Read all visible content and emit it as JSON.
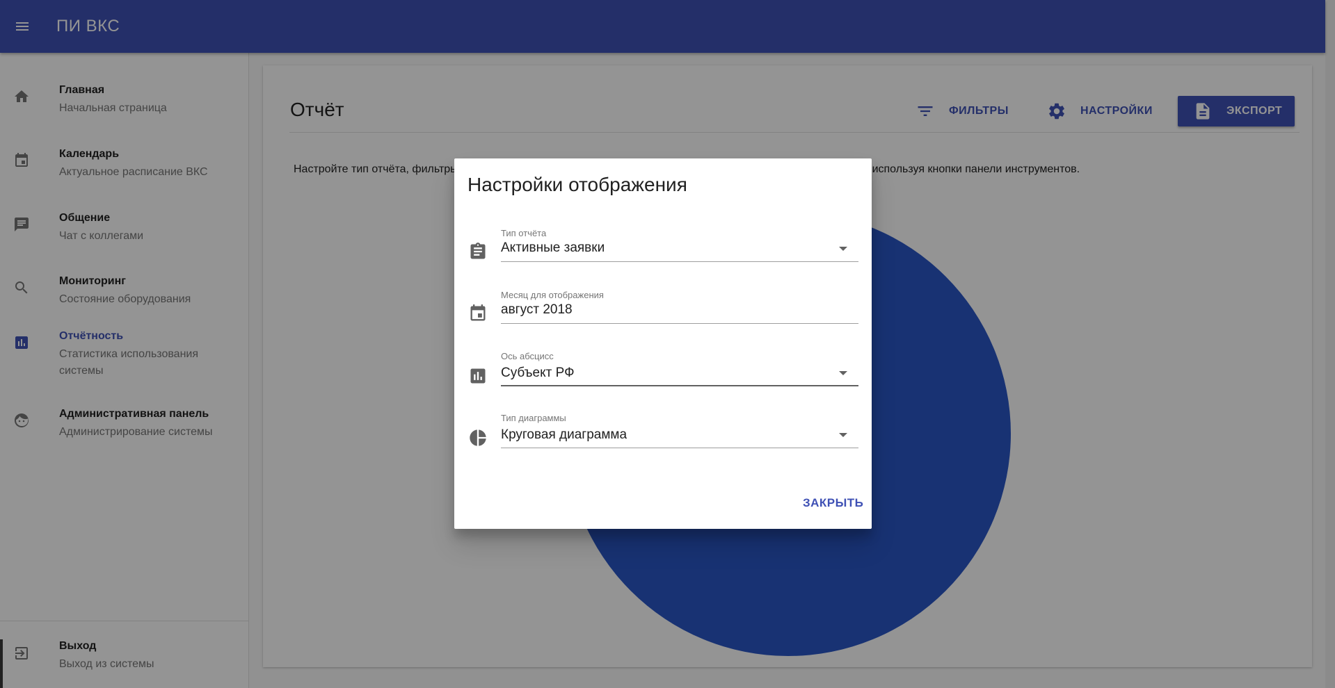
{
  "app": {
    "title": "ПИ ВКС"
  },
  "sidebar": {
    "items": [
      {
        "title": "Главная",
        "subtitle": "Начальная страница",
        "icon": "home-icon"
      },
      {
        "title": "Календарь",
        "subtitle": "Актуальное расписание ВКС",
        "icon": "calendar-icon"
      },
      {
        "title": "Общение",
        "subtitle": "Чат с коллегами",
        "icon": "chat-icon"
      },
      {
        "title": "Мониторинг",
        "subtitle": "Состояние оборудования",
        "icon": "search-icon"
      },
      {
        "title": "Отчётность",
        "subtitle": "Статистика использования системы",
        "icon": "chart-icon",
        "active": true
      },
      {
        "title": "Административная панель",
        "subtitle": "Администрирование системы",
        "icon": "face-icon"
      }
    ],
    "logout": {
      "title": "Выход",
      "subtitle": "Выход из системы",
      "icon": "logout-icon"
    }
  },
  "report": {
    "title": "Отчёт",
    "toolbar": {
      "filters_label": "ФИЛЬТРЫ",
      "settings_label": "НАСТРОЙКИ",
      "export_label": "ЭКСПОРТ"
    },
    "description": "Настройте тип отчёта, фильтры данных и способ отображения, а также экспортируйте полученную диаграмму, используя кнопки панели инструментов."
  },
  "chart_data": {
    "type": "pie",
    "categories": [
      ""
    ],
    "values": [
      100
    ],
    "colors": [
      "#2a56c6"
    ]
  },
  "dialog": {
    "title": "Настройки отображения",
    "fields": [
      {
        "label": "Тип отчёта",
        "value": "Активные заявки",
        "icon": "clipboard-icon",
        "dropdown": true
      },
      {
        "label": "Месяц для отображения",
        "value": "август 2018",
        "icon": "calendar-icon",
        "dropdown": false
      },
      {
        "label": "Ось абсцисс",
        "value": "Субъект РФ",
        "icon": "bar-chart-icon",
        "dropdown": true
      },
      {
        "label": "Тип диаграммы",
        "value": "Круговая диаграмма",
        "icon": "pie-chart-icon",
        "dropdown": true
      }
    ],
    "close_label": "ЗАКРЫТЬ"
  },
  "colors": {
    "primary": "#3f51b5",
    "overlay": "rgba(0,0,0,0.42)",
    "pie": "#2a56c6"
  }
}
